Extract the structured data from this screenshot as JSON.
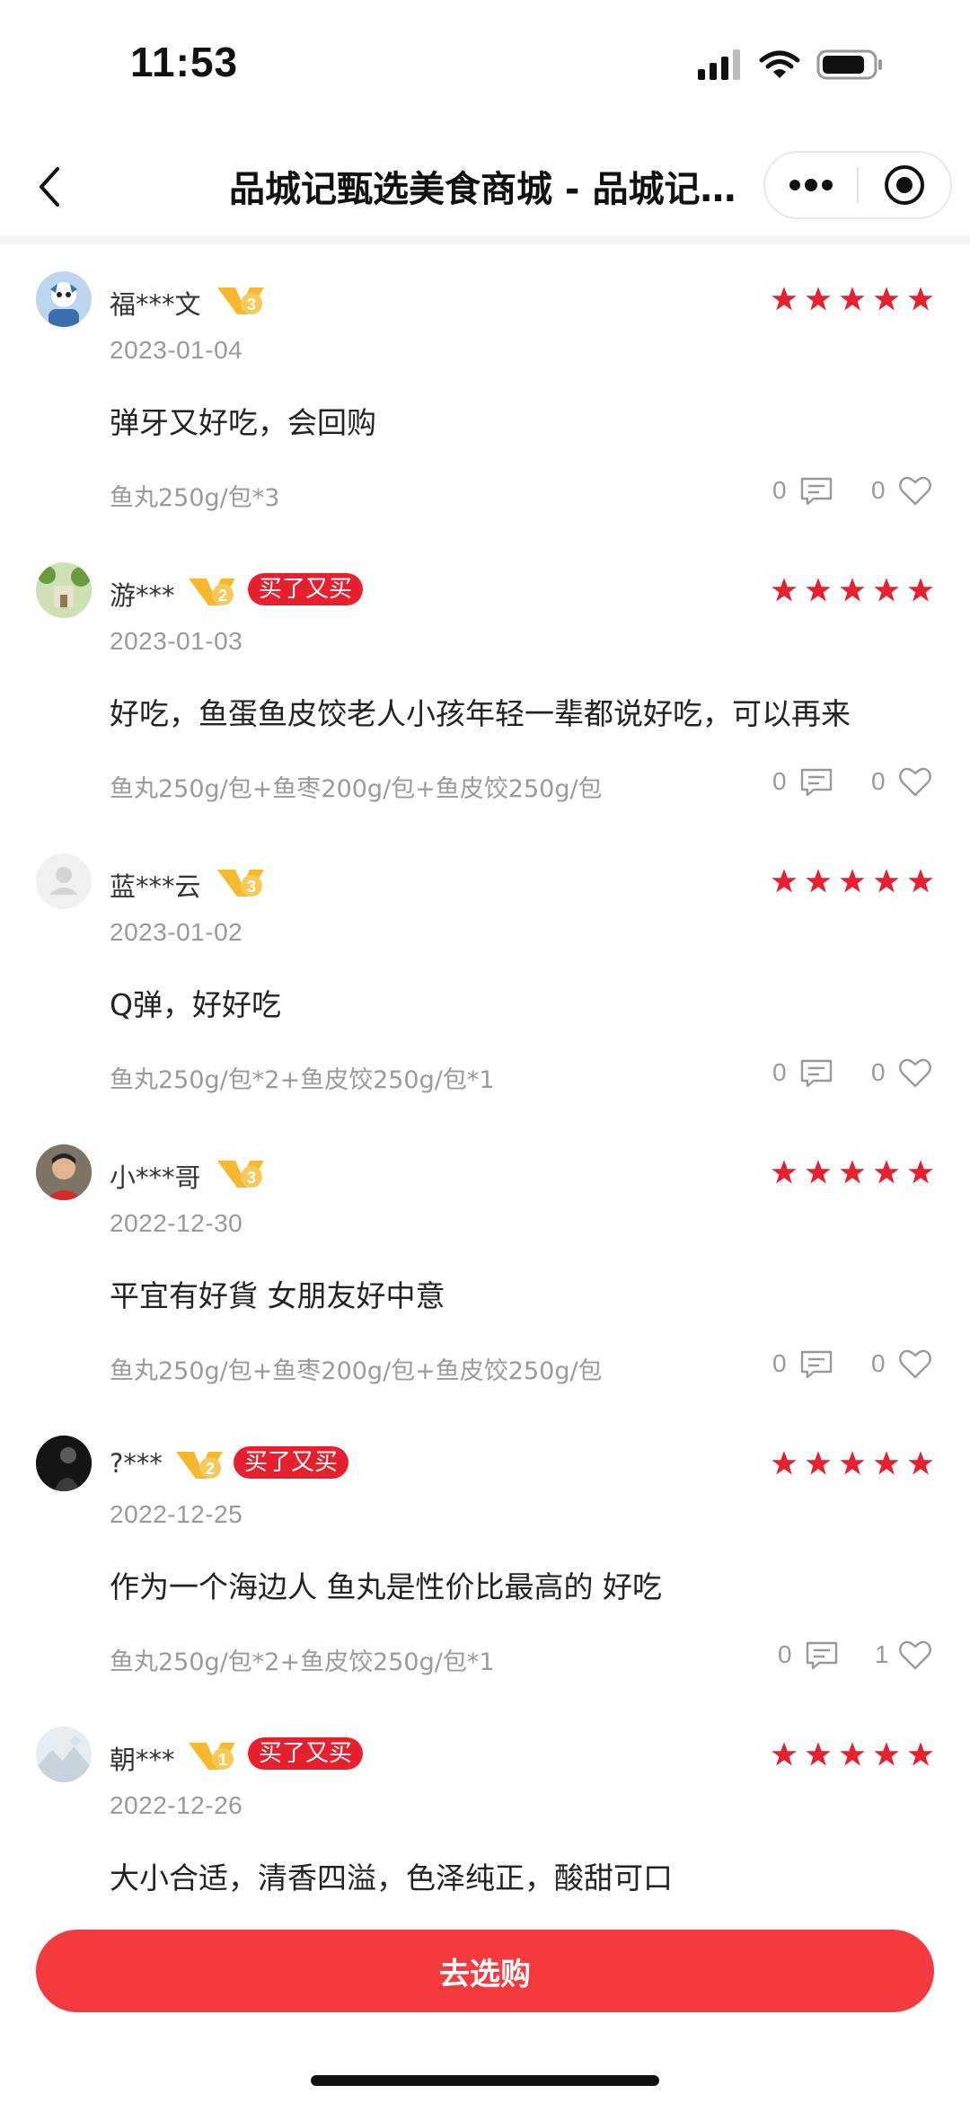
{
  "status_bar": {
    "time": "11:53"
  },
  "nav": {
    "title": "品城记甄选美食商城 - 品城记甄选美食商城",
    "icons": [
      "back-icon",
      "more-icon",
      "close-miniprogram-icon"
    ]
  },
  "colors": {
    "accent": "#e6202f",
    "button": "#f23a3f",
    "star": "#e6202f",
    "badge": "#f5b82e"
  },
  "reviews": [
    {
      "user": "福***文",
      "level": "3",
      "repurchase": "",
      "rating": 5,
      "date": "2023-01-04",
      "content": "弹牙又好吃，会回购",
      "spec": "鱼丸250g/包*3",
      "comments": "0",
      "likes": "0"
    },
    {
      "user": "游***",
      "level": "2",
      "repurchase": "买了又买",
      "rating": 5,
      "date": "2023-01-03",
      "content": "好吃，鱼蛋鱼皮饺老人小孩年轻一辈都说好吃，可以再来",
      "spec": "鱼丸250g/包+鱼枣200g/包+鱼皮饺250g/包",
      "comments": "0",
      "likes": "0"
    },
    {
      "user": "蓝***云",
      "level": "3",
      "repurchase": "",
      "rating": 5,
      "date": "2023-01-02",
      "content": "Q弹，好好吃",
      "spec": "鱼丸250g/包*2+鱼皮饺250g/包*1",
      "comments": "0",
      "likes": "0"
    },
    {
      "user": "小***哥",
      "level": "3",
      "repurchase": "",
      "rating": 5,
      "date": "2022-12-30",
      "content": "平宜有好貨 女朋友好中意",
      "spec": "鱼丸250g/包+鱼枣200g/包+鱼皮饺250g/包",
      "comments": "0",
      "likes": "0"
    },
    {
      "user": "?***",
      "level": "2",
      "repurchase": "买了又买",
      "rating": 5,
      "date": "2022-12-25",
      "content": "作为一个海边人 鱼丸是性价比最高的 好吃",
      "spec": "鱼丸250g/包*2+鱼皮饺250g/包*1",
      "comments": "0",
      "likes": "1"
    },
    {
      "user": "朝***",
      "level": "1",
      "repurchase": "买了又买",
      "rating": 5,
      "date": "2022-12-26",
      "content": "大小合适，清香四溢，色泽纯正，酸甜可口",
      "spec": "",
      "comments": "",
      "likes": ""
    }
  ],
  "bottom": {
    "buy_label": "去选购"
  }
}
